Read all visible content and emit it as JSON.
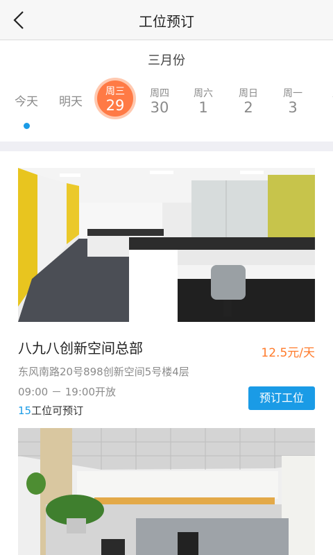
{
  "header": {
    "title": "工位预订"
  },
  "calendar": {
    "month": "三月份",
    "days": [
      {
        "label": "今天"
      },
      {
        "label": "明天"
      },
      {
        "weekday": "周三",
        "date": "29"
      },
      {
        "weekday": "周四",
        "date": "30"
      },
      {
        "weekday": "周六",
        "date": "1"
      },
      {
        "weekday": "周日",
        "date": "2"
      },
      {
        "weekday": "周一",
        "date": "3"
      },
      {
        "weekday": "周"
      }
    ]
  },
  "listings": [
    {
      "name": "八九八创新空间总部",
      "price": "12.5元/天",
      "address": "东风南路20号898创新空间5号楼4层",
      "hours": "09:00 － 19:00开放",
      "available_count": "15",
      "available_suffix": "工位可预订",
      "button": "预订工位"
    }
  ],
  "colors": {
    "accent": "#1a9be6",
    "selected_day": "#ff7a45",
    "price": "#ff7a2a"
  }
}
